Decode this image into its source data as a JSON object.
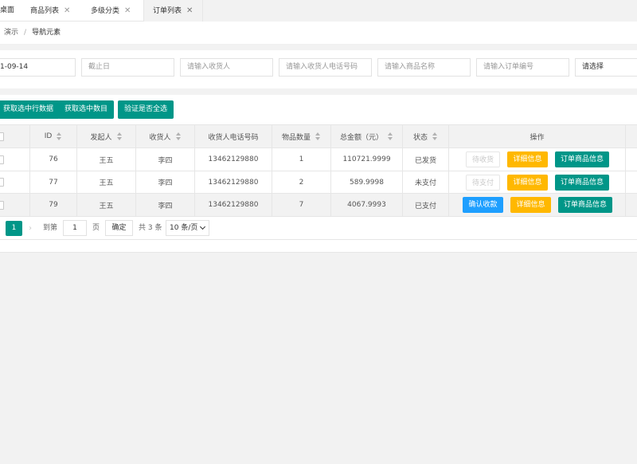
{
  "tabs": [
    {
      "label": "桌面",
      "closable": false
    },
    {
      "label": "商品列表",
      "closable": true
    },
    {
      "label": "多级分类",
      "closable": true
    },
    {
      "label": "订单列表",
      "closable": true,
      "active": true
    }
  ],
  "tab_close_glyph": "✕",
  "breadcrumb": {
    "items": [
      "演示",
      "导航元素"
    ],
    "separator": "/"
  },
  "filters": {
    "start_date_value": "1-09-14",
    "end_date_placeholder": "截止日",
    "consignee_placeholder": "请输入收货人",
    "phone_placeholder": "请输入收货人电话号码",
    "product_placeholder": "请输入商品名称",
    "order_no_placeholder": "请输入订单编号",
    "select_value": "请选择"
  },
  "toolbar": {
    "get_rows_label": "获取选中行数据",
    "get_count_label": "获取选中数目",
    "check_all_label": "验证是否全选"
  },
  "table": {
    "headers": [
      "ID",
      "发起人",
      "收货人",
      "收货人电话号码",
      "物品数量",
      "总金额（元）",
      "状态",
      "操作"
    ],
    "rows": [
      {
        "id": "76",
        "initiator": "王五",
        "consignee": "李四",
        "phone": "13462129880",
        "qty": "1",
        "amount": "110721.9999",
        "status": "已发货",
        "action": "待收货",
        "action_enabled": false,
        "detail": "详细信息",
        "goods": "订单商品信息"
      },
      {
        "id": "77",
        "initiator": "王五",
        "consignee": "李四",
        "phone": "13462129880",
        "qty": "2",
        "amount": "589.9998",
        "status": "未支付",
        "action": "待支付",
        "action_enabled": false,
        "detail": "详细信息",
        "goods": "订单商品信息"
      },
      {
        "id": "79",
        "initiator": "王五",
        "consignee": "李四",
        "phone": "13462129880",
        "qty": "7",
        "amount": "4067.9993",
        "status": "已支付",
        "action": "确认收款",
        "action_enabled": true,
        "detail": "详细信息",
        "goods": "订单商品信息"
      }
    ]
  },
  "pagination": {
    "current_page": "1",
    "next_glyph": "›",
    "goto_label": "到第",
    "goto_value": "1",
    "page_unit": "页",
    "confirm_label": "确定",
    "total_label": "共 3 条",
    "page_size": "10 条/页"
  },
  "colors": {
    "primary": "#009688",
    "warm": "#ffb800",
    "blue": "#1e9fff"
  }
}
